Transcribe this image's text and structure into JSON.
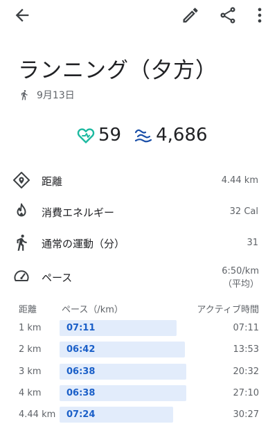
{
  "header": {
    "title": "ランニング（夕方）",
    "date": "9月13日"
  },
  "stats": {
    "heart_points": "59",
    "steps": "4,686",
    "heart_color": "#1db9a0",
    "steps_color": "#1a4fa8"
  },
  "metrics": [
    {
      "label": "距離",
      "value": "4.44 km",
      "icon": "location-diamond-icon"
    },
    {
      "label": "消費エネルギー",
      "value": "32 Cal",
      "icon": "flame-icon"
    },
    {
      "label": "通常の運動（分）",
      "value": "31",
      "icon": "walking-person-icon"
    },
    {
      "label": "ペース",
      "value": "6:50/km",
      "value_note": "（平均）",
      "icon": "speedometer-icon"
    }
  ],
  "splits": {
    "headers": {
      "distance": "距離",
      "pace": "ペース（/km）",
      "active_time": "アクティブ時間"
    },
    "bar_color": "#e2ecfb",
    "pace_color": "#1a5fc8",
    "rows": [
      {
        "distance": "1 km",
        "pace": "07:11",
        "active_time": "07:11",
        "pace_seconds": 431
      },
      {
        "distance": "2 km",
        "pace": "06:42",
        "active_time": "13:53",
        "pace_seconds": 402
      },
      {
        "distance": "3 km",
        "pace": "06:38",
        "active_time": "20:32",
        "pace_seconds": 398
      },
      {
        "distance": "4 km",
        "pace": "06:38",
        "active_time": "27:10",
        "pace_seconds": 398
      },
      {
        "distance": "4.44 km",
        "pace": "07:24",
        "active_time": "30:27",
        "pace_seconds": 444
      }
    ]
  }
}
